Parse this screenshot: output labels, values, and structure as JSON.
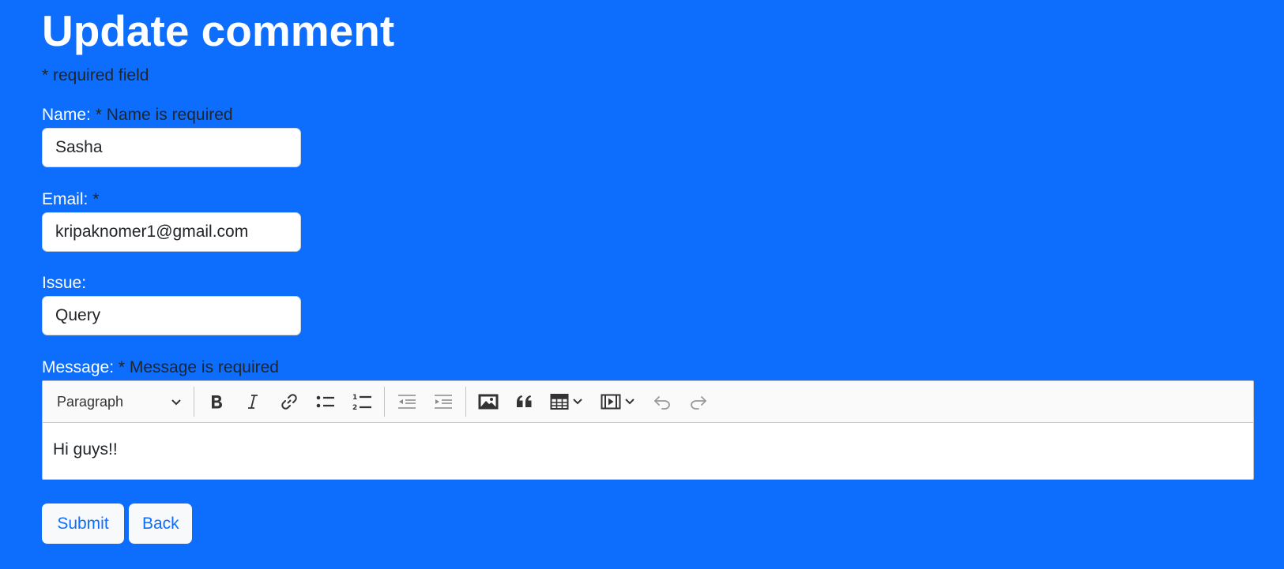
{
  "page": {
    "title": "Update comment",
    "required_note": "* required field"
  },
  "form": {
    "name": {
      "label": "Name:",
      "error": " * Name is required",
      "value": "Sasha"
    },
    "email": {
      "label": "Email:",
      "error": " *",
      "value": "kripaknomer1@gmail.com"
    },
    "issue": {
      "label": "Issue:",
      "value": "Query"
    },
    "message": {
      "label": "Message:",
      "error": " * Message is required",
      "content": "Hi guys!!"
    }
  },
  "editor": {
    "heading_select": "Paragraph",
    "toolbar_icons": [
      "bold-icon",
      "italic-icon",
      "link-icon",
      "bulleted-list-icon",
      "numbered-list-icon",
      "outdent-icon",
      "indent-icon",
      "image-icon",
      "blockquote-icon",
      "table-icon",
      "media-icon",
      "undo-icon",
      "redo-icon"
    ]
  },
  "buttons": {
    "submit": "Submit",
    "back": "Back"
  },
  "colors": {
    "background": "#0d6efd",
    "button_text": "#0d6efd",
    "button_bg": "#f8f9fa",
    "error_text": "#212529"
  }
}
